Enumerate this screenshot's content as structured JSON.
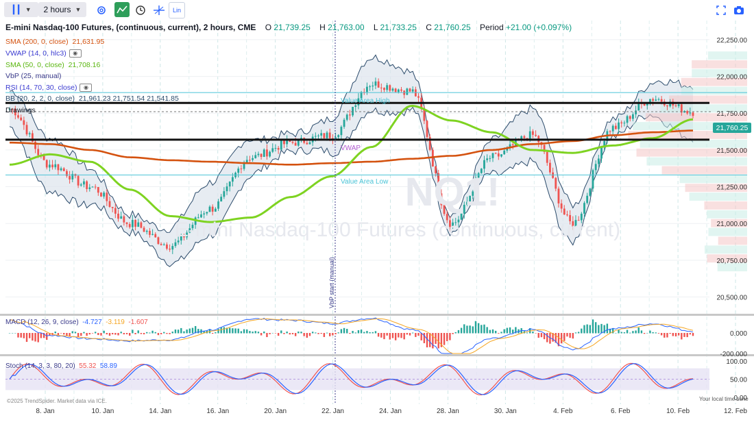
{
  "toolbar": {
    "timeframe": "2 hours",
    "lin_label": "Lin"
  },
  "header": {
    "symbol": "E-mini Nasdaq-100 Futures, (continuous, current), 2 hours, CME",
    "o_label": "O",
    "o_value": "21,739.25",
    "h_label": "H",
    "h_value": "21,763.00",
    "l_label": "L",
    "l_value": "21,733.25",
    "c_label": "C",
    "c_value": "21,760.25",
    "period_label": "Period",
    "period_value": "+21.00 (+0.097%)"
  },
  "legend": {
    "sma200_label": "SMA (200, 0, close)",
    "sma200_value": "21,631.95",
    "vwap_label": "VWAP (14, 0, hlc3)",
    "sma50_label": "SMA (50, 0, close)",
    "sma50_value": "21,708.16",
    "vbp_label": "VbP (25, manual)",
    "rsi_label": "RSI (14, 70, 30, close)",
    "bb_label": "BB (20, 2, 2, 0, close)",
    "bb_values": "21,961.23  21,751.54  21,541.85",
    "drawings_label": "Drawings",
    "macd_label": "MACD (12, 26, 9, close)",
    "macd_v1": "-4.727",
    "macd_v2": "-3.119",
    "macd_v3": "-1.607",
    "stoch_label": "Stoch (14, 3, 3, 80, 20)",
    "stoch_v1": "55.32",
    "stoch_v2": "58.89"
  },
  "annotations": {
    "value_area_high": "Value Area High",
    "value_area_low": "Value Area Low",
    "vwap_mark": "VWAP",
    "vbp_start": "VbP start (manual)",
    "watermark_symbol": "NQ1!",
    "watermark_name": "E-mini Nasdaq-100 Futures (continuous, current)",
    "copyright": "©2025 TrendSpider. Market data via ICE.",
    "local_time": "Your local time zone"
  },
  "price_badge": "21,760.25",
  "colors": {
    "up": "#26a69a",
    "down": "#ef5350",
    "sma200": "#d4520f",
    "sma50": "#7ed321",
    "bb": "#2a4a6a",
    "vwap_color": "#3a3ad0",
    "value_area": "#49c3d6"
  },
  "chart_data": [
    {
      "type": "line",
      "title": "E-mini Nasdaq-100 Futures, (continuous, current), 2 hours, CME",
      "x_ticks": [
        "8. Jan",
        "10. Jan",
        "14. Jan",
        "16. Jan",
        "20. Jan",
        "22. Jan",
        "24. Jan",
        "28. Jan",
        "30. Jan",
        "4. Feb",
        "6. Feb",
        "10. Feb",
        "12. Feb"
      ],
      "y_ticks": [
        "22,250.00",
        "22,000.00",
        "21,750.00",
        "21,500.00",
        "21,250.00",
        "21,000.00",
        "20,750.00",
        "20,500.00"
      ],
      "ylim": [
        20400,
        22380
      ],
      "series": [
        {
          "name": "SMA (200, 0, close)",
          "values": [
            21550,
            21540,
            21500,
            21450,
            21430,
            21420,
            21410,
            21400,
            21410,
            21420,
            21440,
            21460,
            21500,
            21540,
            21560,
            21600,
            21620,
            21632
          ]
        },
        {
          "name": "SMA (50, 0, close)",
          "values": [
            21400,
            21470,
            21420,
            21230,
            21050,
            21010,
            21040,
            21180,
            21320,
            21520,
            21800,
            21700,
            21620,
            21500,
            21480,
            21530,
            21580,
            21708
          ]
        },
        {
          "name": "Close",
          "values": [
            21780,
            21400,
            21250,
            21000,
            20850,
            21100,
            21450,
            21550,
            21600,
            21950,
            21900,
            21000,
            21450,
            21600,
            21000,
            21650,
            21850,
            21760
          ]
        }
      ],
      "overlays": {
        "value_area_high": 21890,
        "value_area_low": 21330,
        "level_upper": 21820,
        "level_lower": 21570
      },
      "last_price": 21760.25
    },
    {
      "type": "bar",
      "title": "MACD (12, 26, 9, close)",
      "y_ticks": [
        "0.000",
        "-200.000"
      ],
      "values_label": [
        "-4.727",
        "-3.119",
        "-1.607"
      ]
    },
    {
      "type": "line",
      "title": "Stoch (14, 3, 3, 80, 20)",
      "y_ticks": [
        "100.00",
        "50.00",
        "0.00"
      ],
      "ylim": [
        0,
        100
      ],
      "values_label": [
        "55.32",
        "58.89"
      ]
    }
  ]
}
